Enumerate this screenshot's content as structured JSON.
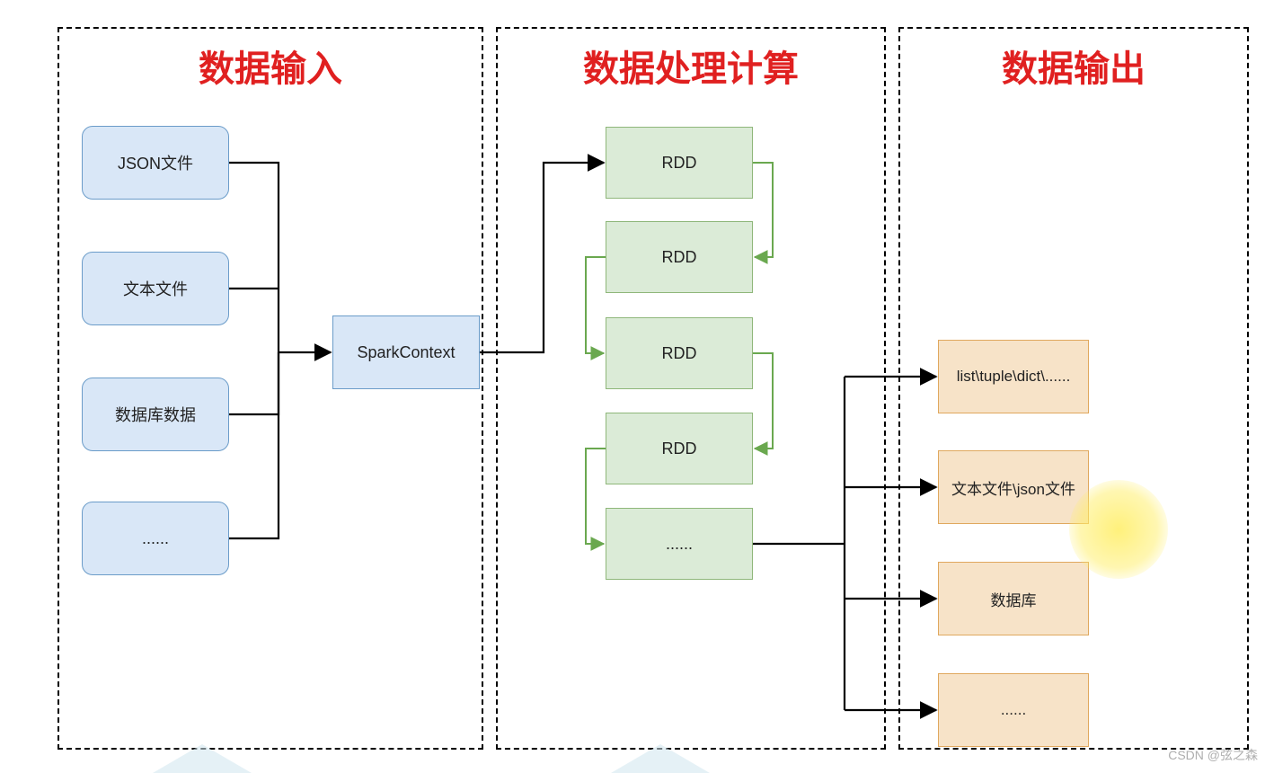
{
  "panels": {
    "input": {
      "title": "数据输入"
    },
    "compute": {
      "title": "数据处理计算"
    },
    "output": {
      "title": "数据输出"
    }
  },
  "input_nodes": {
    "json": "JSON文件",
    "text": "文本文件",
    "db": "数据库数据",
    "more": "......"
  },
  "spark_context": "SparkContext",
  "rdd_nodes": {
    "r1": "RDD",
    "r2": "RDD",
    "r3": "RDD",
    "r4": "RDD",
    "r5": "......"
  },
  "output_nodes": {
    "o1": "list\\tuple\\dict\\......",
    "o2": "文本文件\\json文件",
    "o3": "数据库",
    "o4": "......"
  },
  "watermark": "CSDN @弦之森"
}
